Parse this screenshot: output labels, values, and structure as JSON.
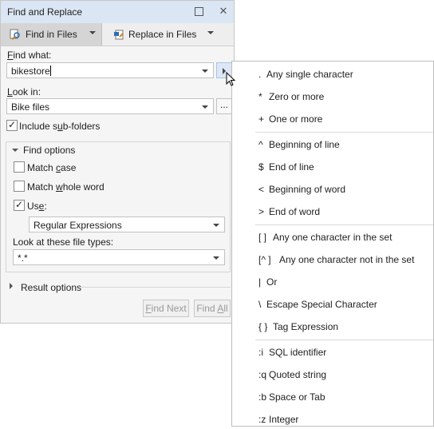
{
  "window": {
    "title": "Find and Replace"
  },
  "tabs": [
    {
      "label": "Find in Files",
      "icon": "find-in-files-icon",
      "active": true
    },
    {
      "label": "Replace in Files",
      "icon": "replace-in-files-icon",
      "active": false
    }
  ],
  "find_what": {
    "label_pre": "",
    "label_u": "F",
    "label_post": "ind what:",
    "value": "bikestore"
  },
  "look_in": {
    "label_pre": "",
    "label_u": "L",
    "label_post": "ook in:",
    "value": "Bike files",
    "browse_label": "..."
  },
  "include_subfolders": {
    "label_pre": "Include s",
    "label_u": "u",
    "label_post": "b-folders",
    "checked": true
  },
  "find_options": {
    "header": "Find options",
    "match_case": {
      "label_pre": "Match ",
      "label_u": "c",
      "label_post": "ase",
      "checked": false
    },
    "match_whole_word": {
      "label_pre": "Match ",
      "label_u": "w",
      "label_post": "hole word",
      "checked": false
    },
    "use": {
      "label_pre": "Us",
      "label_u": "e",
      "label_post": ":",
      "checked": true,
      "value": "Regular Expressions"
    },
    "file_types": {
      "label": "Look at these file types:",
      "value": "*.*"
    }
  },
  "result_options": {
    "header": "Result options"
  },
  "buttons": {
    "find_next": {
      "label_u": "F",
      "label_post": "ind Next"
    },
    "find_all": {
      "label_pre": "Find ",
      "label_u": "A",
      "label_post": "ll"
    }
  },
  "regex_menu": {
    "groups": [
      [
        {
          "sym": ".",
          "desc": "Any single character"
        },
        {
          "sym": "*",
          "desc": "Zero or more"
        },
        {
          "sym": "+",
          "desc": "One or more"
        }
      ],
      [
        {
          "sym": "^",
          "desc": "Beginning of line"
        },
        {
          "sym": "$",
          "desc": "End of line"
        },
        {
          "sym": "<",
          "desc": "Beginning of word"
        },
        {
          "sym": ">",
          "desc": "End of word"
        }
      ],
      [
        {
          "sym": "[ ]",
          "desc": "Any one character in the set"
        },
        {
          "sym": "[^ ]",
          "desc": "Any one character not in the set"
        },
        {
          "sym": "|",
          "desc": "Or"
        },
        {
          "sym": "\\",
          "desc": "Escape Special Character"
        },
        {
          "sym": "{ }",
          "desc": "Tag Expression"
        }
      ],
      [
        {
          "sym": ":i",
          "desc": "SQL identifier"
        },
        {
          "sym": ":q",
          "desc": "Quoted string"
        },
        {
          "sym": ":b",
          "desc": "Space or Tab"
        },
        {
          "sym": ":z",
          "desc": "Integer"
        }
      ]
    ]
  },
  "colors": {
    "titlebar": "#dbe6f4",
    "active_tab": "#d5d5d5",
    "panel": "#f5f5f5"
  }
}
